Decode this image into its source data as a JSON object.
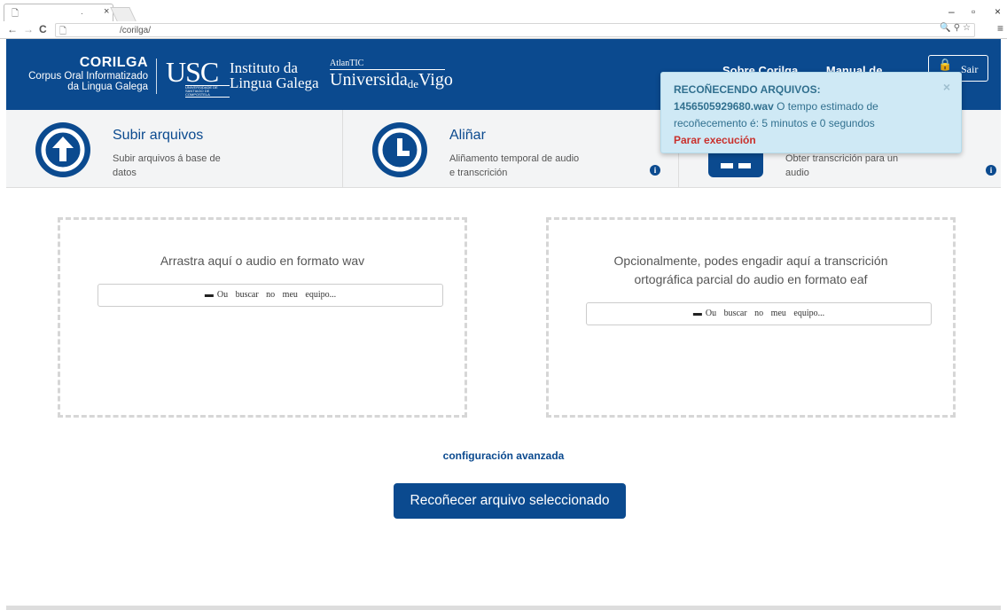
{
  "browser": {
    "tab_title": ".",
    "tab_close": "×",
    "url": "/corilga/",
    "win_min": "–",
    "win_max": "▫",
    "win_close": "×"
  },
  "header": {
    "brand_title": "CORILGA",
    "brand_line2": "Corpus Oral Informatizado",
    "brand_line3": "da Lingua Galega",
    "usc_letters": "USC",
    "usc_sub": "Universidade de Santiago de Compostela",
    "ilg_line1": "Instituto da",
    "ilg_line2": "Lingua Galega",
    "atlantic": "AtlanTIC",
    "uvigo_main": "Universida",
    "uvigo_de": "de",
    "uvigo_end": "Vigo",
    "nav_about": "Sobre Corilga",
    "nav_manual": "Manual de",
    "sair_label": "Sair"
  },
  "tiles": [
    {
      "title": "Subir arquivos",
      "desc": "Subir arquivos á base de datos",
      "icon": "upload-icon"
    },
    {
      "title": "Aliñar",
      "desc": "Aliñamento temporal de audio e transcrición",
      "icon": "clock-icon"
    },
    {
      "title": "",
      "desc": "Obter transcrición para un audio",
      "icon": "transcribe-icon"
    }
  ],
  "dropzones": {
    "audio_text": "Arrastra aquí o audio en formato wav",
    "eaf_text": "Opcionalmente, podes engadir aquí a transcrición ortográfica parcial do audio en formato eaf",
    "browse_label": "Ou buscar no meu equipo..."
  },
  "advanced_link": "configuración avanzada",
  "submit_label": "Recoñecer arquivo seleccionado",
  "notification": {
    "title": "RECOÑECENDO ARQUIVOS:",
    "filename": "1456505929680.wav",
    "message": "O tempo estimado de recoñecemento é: 5 minutos e 0 segundos",
    "stop_link": "Parar execución",
    "close": "×"
  },
  "colors": {
    "primary": "#0b4a8f",
    "alert_bg": "#cfe9f5",
    "stop": "#c9302c"
  }
}
